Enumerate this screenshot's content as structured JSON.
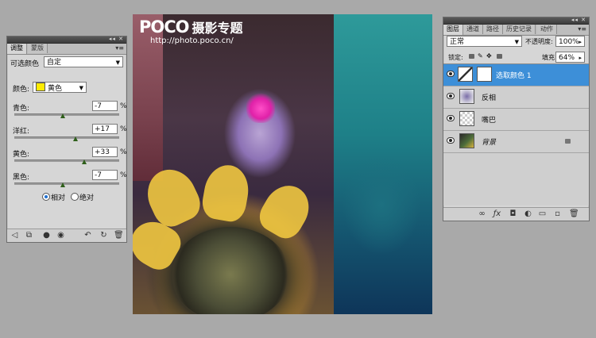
{
  "adjustments": {
    "tabs": [
      {
        "label": "调整",
        "active": true
      },
      {
        "label": "蒙版",
        "active": false
      }
    ],
    "preset_label": "可选颜色",
    "preset_value": "自定",
    "color_label": "颜色:",
    "color_value": "黄色",
    "color_swatch": "#ffeb00",
    "sliders": [
      {
        "label": "青色:",
        "value": "-7",
        "unit": "%",
        "level": -7
      },
      {
        "label": "洋红:",
        "value": "+17",
        "unit": "%",
        "level": 17
      },
      {
        "label": "黄色:",
        "value": "+33",
        "unit": "%",
        "level": 33
      },
      {
        "label": "黑色:",
        "value": "-7",
        "unit": "%",
        "level": -7
      }
    ],
    "method_relative": "相对",
    "method_absolute": "绝对",
    "method_selected": "relative"
  },
  "canvas": {
    "logo_brand": "POCO",
    "logo_cn": "摄影专题",
    "logo_url": "http://photo.poco.cn/"
  },
  "layers": {
    "tabs": [
      {
        "label": "图层",
        "active": true
      },
      {
        "label": "通道",
        "active": false
      },
      {
        "label": "路径",
        "active": false
      },
      {
        "label": "历史记录",
        "active": false
      },
      {
        "label": "动作",
        "active": false
      }
    ],
    "blend_mode": "正常",
    "opacity_label": "不透明度:",
    "opacity_value": "100%",
    "lock_label": "锁定:",
    "fill_label": "填充:",
    "fill_value": "64%",
    "items": [
      {
        "name": "选取颜色 1",
        "selected": true
      },
      {
        "name": "反相",
        "selected": false
      },
      {
        "name": "嘴巴",
        "selected": false
      },
      {
        "name": "背景",
        "selected": false,
        "locked": true
      }
    ]
  }
}
